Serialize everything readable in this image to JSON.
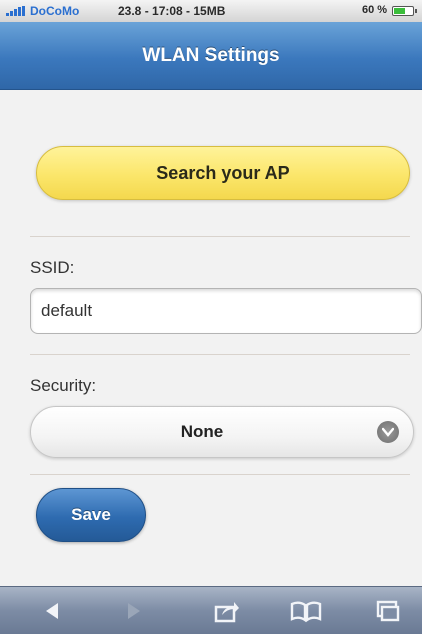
{
  "status_bar": {
    "carrier": "DoCoMo",
    "center_text": "23.8 - 17:08 - 15MB",
    "battery_percent": "60 %",
    "battery_level": 0.6
  },
  "header": {
    "title": "WLAN Settings"
  },
  "search_button": {
    "label": "Search your AP"
  },
  "ssid": {
    "label": "SSID:",
    "value": "default"
  },
  "security": {
    "label": "Security:",
    "selected": "None"
  },
  "save_button": {
    "label": "Save"
  },
  "toolbar": {
    "items": [
      "back-icon",
      "forward-icon",
      "share-icon",
      "bookmarks-icon",
      "tabs-icon"
    ]
  },
  "colors": {
    "header_blue": "#3b78bd",
    "search_yellow": "#fbe66a",
    "save_blue": "#2e6bb0",
    "toolbar_gray": "#7d8ca5"
  }
}
